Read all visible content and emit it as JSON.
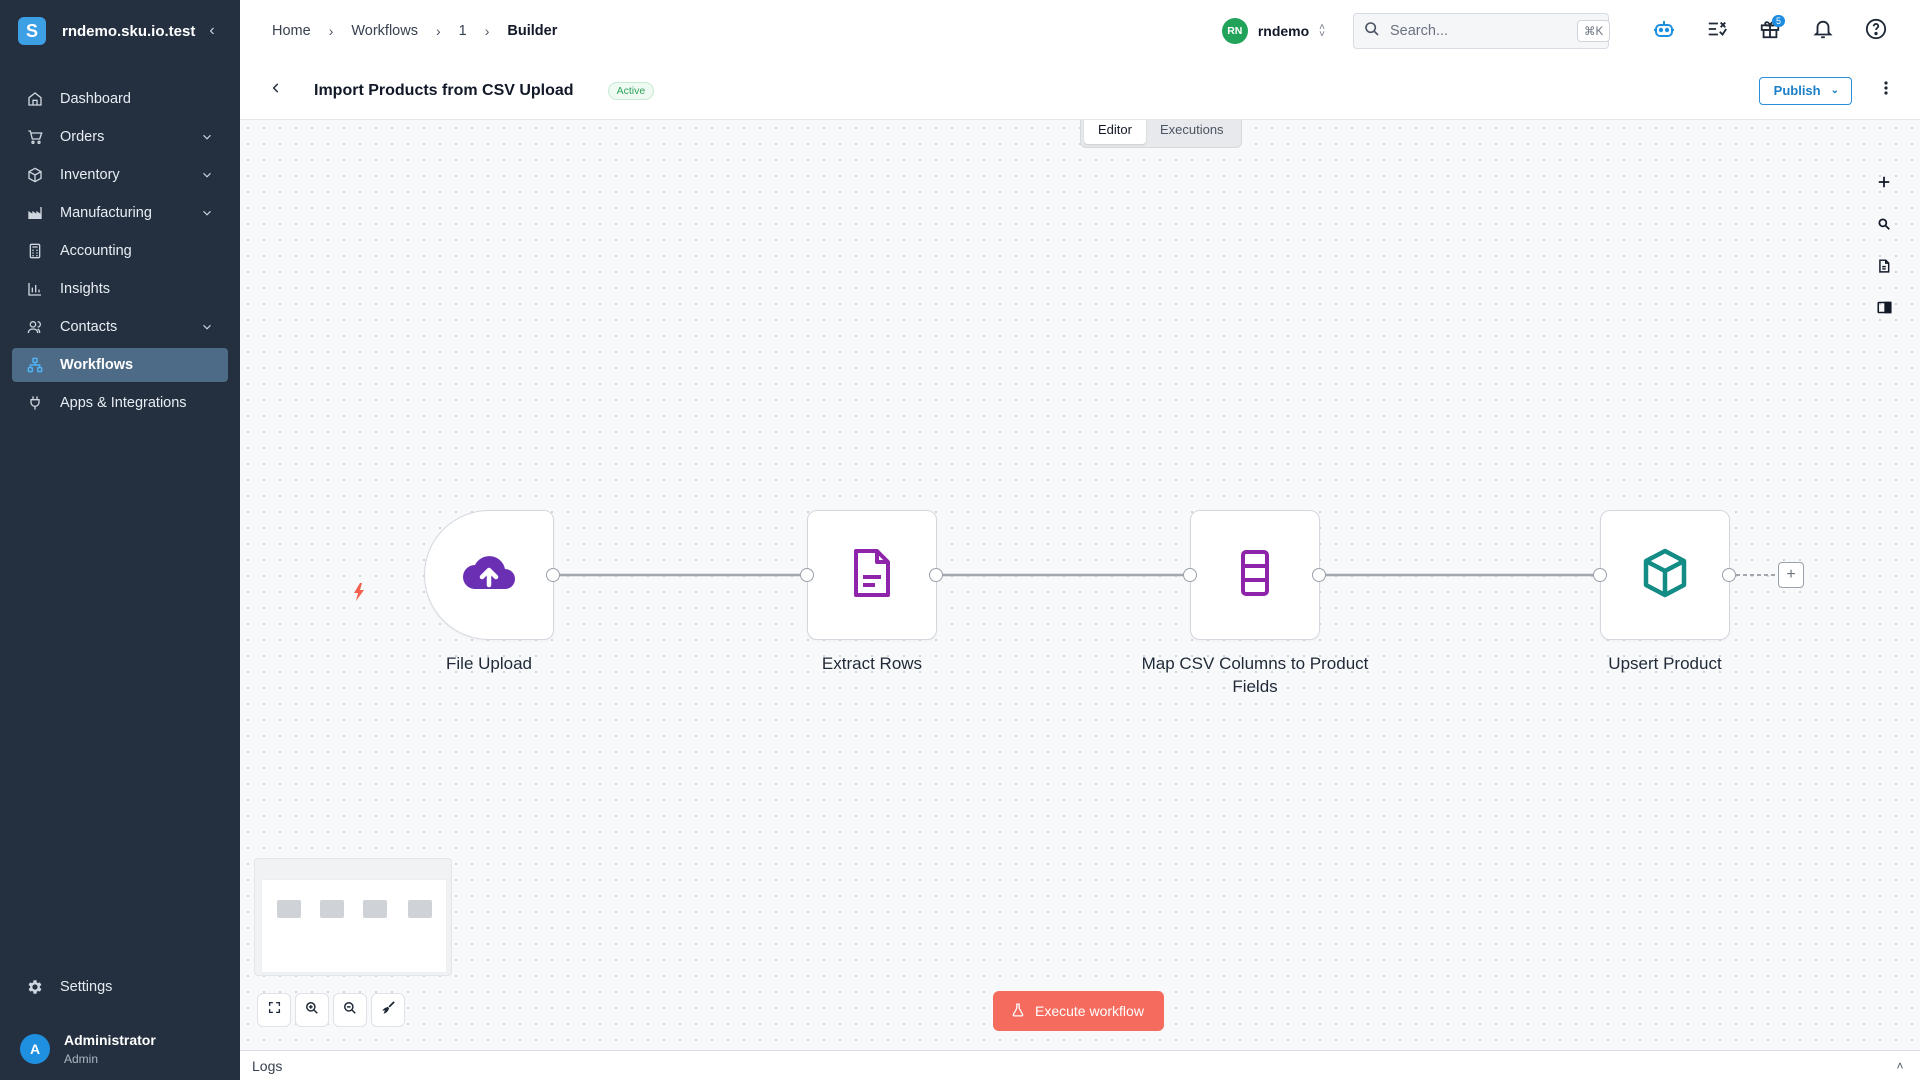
{
  "app": {
    "org_domain": "rndemo.sku.io.test",
    "logo_letter": "S"
  },
  "sidebar": {
    "items": [
      {
        "label": "Dashboard",
        "icon": "home-icon",
        "expandable": false
      },
      {
        "label": "Orders",
        "icon": "cart-icon",
        "expandable": true
      },
      {
        "label": "Inventory",
        "icon": "box-icon",
        "expandable": true
      },
      {
        "label": "Manufacturing",
        "icon": "factory-icon",
        "expandable": true
      },
      {
        "label": "Accounting",
        "icon": "calculator-icon",
        "expandable": false
      },
      {
        "label": "Insights",
        "icon": "bar-chart-icon",
        "expandable": false
      },
      {
        "label": "Contacts",
        "icon": "users-icon",
        "expandable": true
      },
      {
        "label": "Workflows",
        "icon": "workflow-icon",
        "expandable": false,
        "active": true
      },
      {
        "label": "Apps & Integrations",
        "icon": "plug-icon",
        "expandable": false
      }
    ],
    "settings_label": "Settings",
    "user": {
      "initial": "A",
      "name": "Administrator",
      "role": "Admin"
    }
  },
  "breadcrumb": [
    "Home",
    "Workflows",
    "1",
    "Builder"
  ],
  "org_switcher": {
    "initials": "RN",
    "name": "rndemo"
  },
  "search": {
    "placeholder": "Search...",
    "shortcut": "⌘K"
  },
  "notifications": {
    "gift_badge": "5"
  },
  "workflow": {
    "title": "Import Products from CSV Upload",
    "status": "Active",
    "publish_label": "Publish"
  },
  "tabs": [
    {
      "label": "Editor",
      "active": true
    },
    {
      "label": "Executions",
      "active": false
    }
  ],
  "nodes": [
    {
      "label": "File Upload",
      "icon": "cloud-upload-icon",
      "color": "#6b2fb3"
    },
    {
      "label": "Extract Rows",
      "icon": "file-text-icon",
      "color": "#8e24aa"
    },
    {
      "label": "Map CSV Columns to Product Fields",
      "icon": "columns-icon",
      "color": "#8e24aa"
    },
    {
      "label": "Upsert Product",
      "icon": "cube-icon",
      "color": "#138c86"
    }
  ],
  "execute_label": "Execute workflow",
  "logs_label": "Logs",
  "colors": {
    "sidebar_bg": "#243040",
    "active_nav": "#4d6a86",
    "accent": "#2a8fd8",
    "execute": "#f56b5d",
    "status_green": "#2fa35b"
  }
}
